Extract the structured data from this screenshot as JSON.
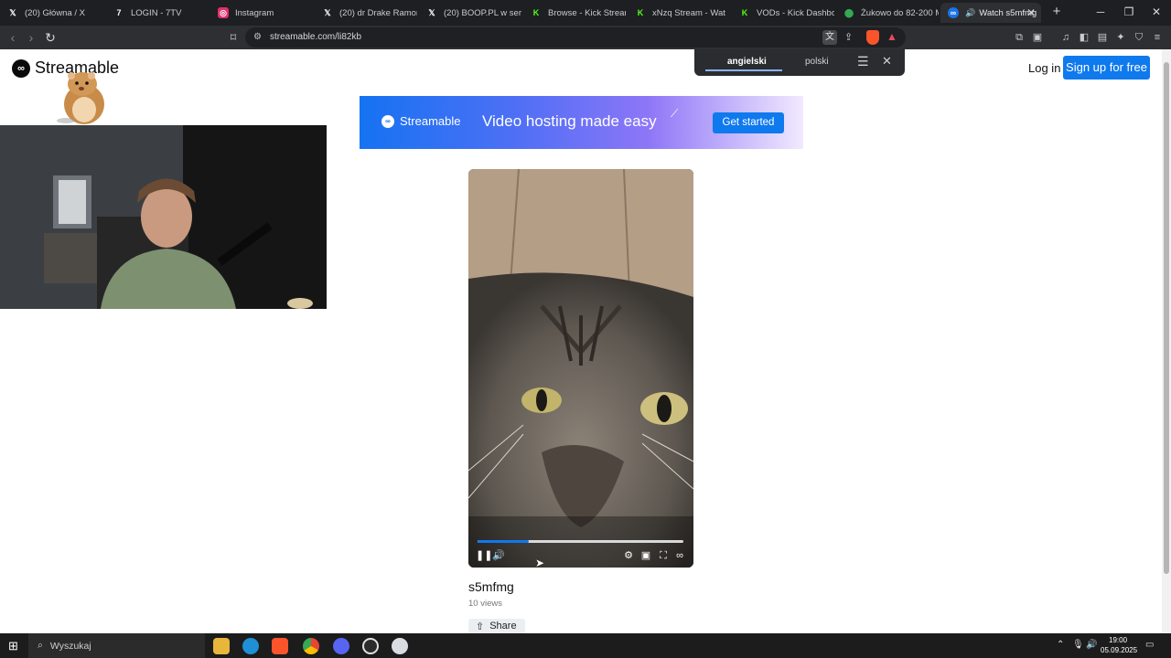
{
  "browser": {
    "tabs": [
      {
        "label": "(20) Główna / X",
        "icon": "x-logo-icon",
        "active": false
      },
      {
        "label": "LOGIN - 7TV",
        "icon": "7tv-logo-icon",
        "active": false
      },
      {
        "label": "Instagram",
        "icon": "instagram-logo-icon",
        "active": false
      },
      {
        "label": "(20) dr Drake Ramoray",
        "icon": "x-logo-icon",
        "active": false
      },
      {
        "label": "(20) BOOP.PL w serwis",
        "icon": "x-logo-icon",
        "active": false
      },
      {
        "label": "Browse - Kick Streamin",
        "icon": "kick-logo-icon",
        "active": false
      },
      {
        "label": "xNzq Stream - Wat",
        "icon": "kick-logo-icon",
        "active": false
      },
      {
        "label": "VODs - Kick Dashboa",
        "icon": "kick-logo-icon",
        "active": false
      },
      {
        "label": "Żukowo do 82-200 Ma",
        "icon": "maps-pin-icon",
        "active": false
      },
      {
        "label": "Watch s5mfmg",
        "icon": "streamable-logo-icon",
        "active": true
      }
    ],
    "new_tab": "+",
    "url": "streamable.com/li82kb",
    "translate": {
      "source": "angielski",
      "target": "polski"
    },
    "colors": {
      "kick": "#53fc18",
      "instagram": "#e1306c",
      "maps": "#34a853",
      "active_tab": "#2d2f33"
    }
  },
  "page": {
    "logo": "Streamable",
    "login": "Log in",
    "signup": "Sign up for free",
    "banner": {
      "brand": "Streamable",
      "tagline": "Video hosting made easy",
      "cta": "Get started"
    },
    "video": {
      "progress_played": 0.25,
      "progress_buffered": 0.25,
      "title": "s5mfmg",
      "views": "10 views",
      "share": "Share"
    },
    "colors": {
      "brand_blue": "#0f79ee"
    }
  },
  "taskbar": {
    "search_placeholder": "Wyszukaj",
    "time": "19:00",
    "date": "05.09.2025"
  }
}
